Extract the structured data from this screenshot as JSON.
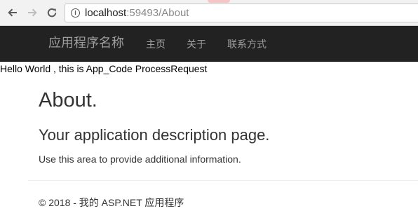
{
  "browser": {
    "url_host": "localhost",
    "url_rest": ":59493/About",
    "back_icon": "arrow-left-icon",
    "forward_icon": "arrow-right-icon",
    "reload_icon": "reload-icon",
    "info_icon": "info-icon",
    "info_glyph": "i"
  },
  "navbar": {
    "brand": "应用程序名称",
    "links": [
      "主页",
      "关于",
      "联系方式"
    ]
  },
  "page": {
    "debug_text": "Hello World , this is App_Code ProcessRequest",
    "title": "About.",
    "subtitle": "Your application description page.",
    "body": "Use this area to provide additional information.",
    "footer": "© 2018 - 我的 ASP.NET 应用程序"
  },
  "colors": {
    "navbar_bg": "#222222",
    "navbar_text": "#9d9d9d",
    "body_text": "#333333"
  }
}
